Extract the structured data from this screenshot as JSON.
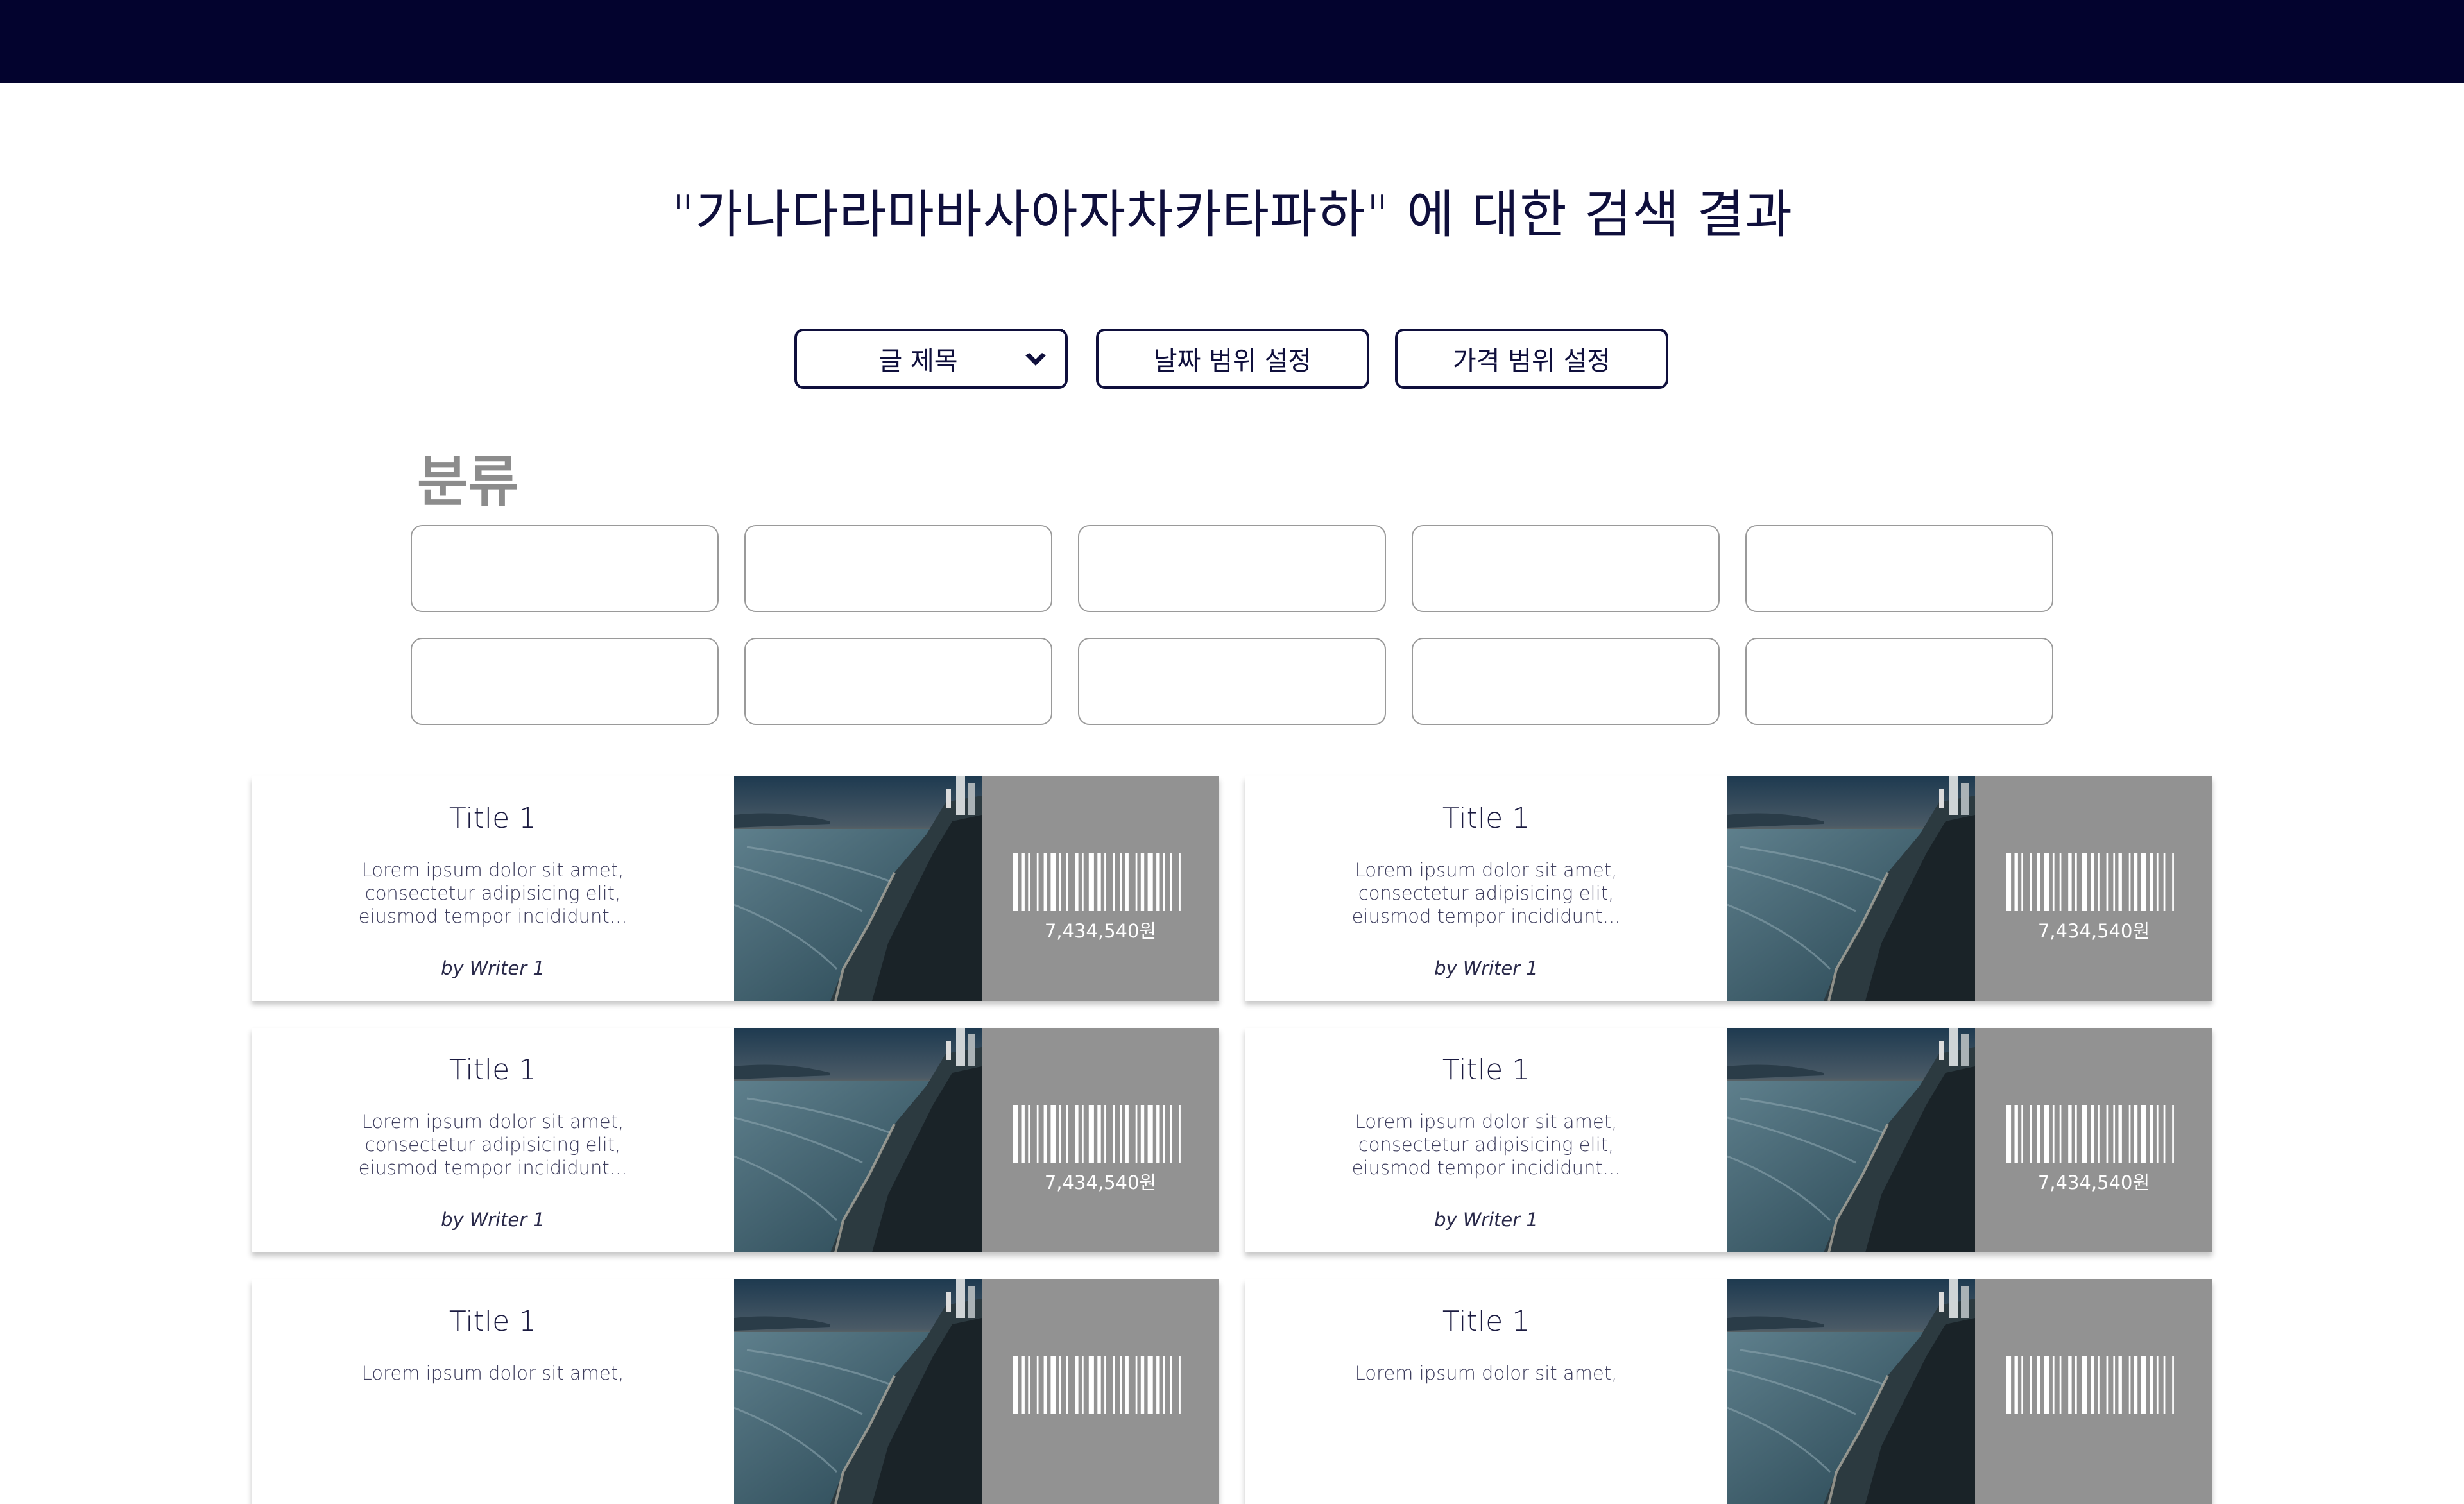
{
  "header": {},
  "search": {
    "title": "\"가나다라마바사아자차카타파하\" 에 대한 검색 결과"
  },
  "filters": {
    "sort_select": {
      "label": "글 제목"
    },
    "date_range_label": "날짜 범위 설정",
    "price_range_label": "가격 범위 설정"
  },
  "categories": {
    "heading": "분류",
    "items": [
      "",
      "",
      "",
      "",
      "",
      "",
      "",
      "",
      "",
      ""
    ]
  },
  "results": [
    {
      "title": "Title 1",
      "description": "Lorem ipsum dolor sit amet, consectetur adipisicing elit, eiusmod tempor incididunt...",
      "writer": "by Writer 1",
      "price": "7,434,540원"
    },
    {
      "title": "Title 1",
      "description": "Lorem ipsum dolor sit amet, consectetur adipisicing elit, eiusmod tempor incididunt...",
      "writer": "by Writer 1",
      "price": "7,434,540원"
    },
    {
      "title": "Title 1",
      "description": "Lorem ipsum dolor sit amet, consectetur adipisicing elit, eiusmod tempor incididunt...",
      "writer": "by Writer 1",
      "price": "7,434,540원"
    },
    {
      "title": "Title 1",
      "description": "Lorem ipsum dolor sit amet, consectetur adipisicing elit, eiusmod tempor incididunt...",
      "writer": "by Writer 1",
      "price": "7,434,540원"
    },
    {
      "title": "Title 1",
      "description": "Lorem ipsum dolor sit amet,",
      "writer": "",
      "price": ""
    },
    {
      "title": "Title 1",
      "description": "Lorem ipsum dolor sit amet,",
      "writer": "",
      "price": ""
    }
  ],
  "colors": {
    "header": "#03032e",
    "text": "#0f0f3c",
    "ticket": "#929292",
    "muted": "#8c8c8c"
  },
  "icons": {
    "dropdown": "chevron-down-icon",
    "barcode": "barcode-icon"
  }
}
